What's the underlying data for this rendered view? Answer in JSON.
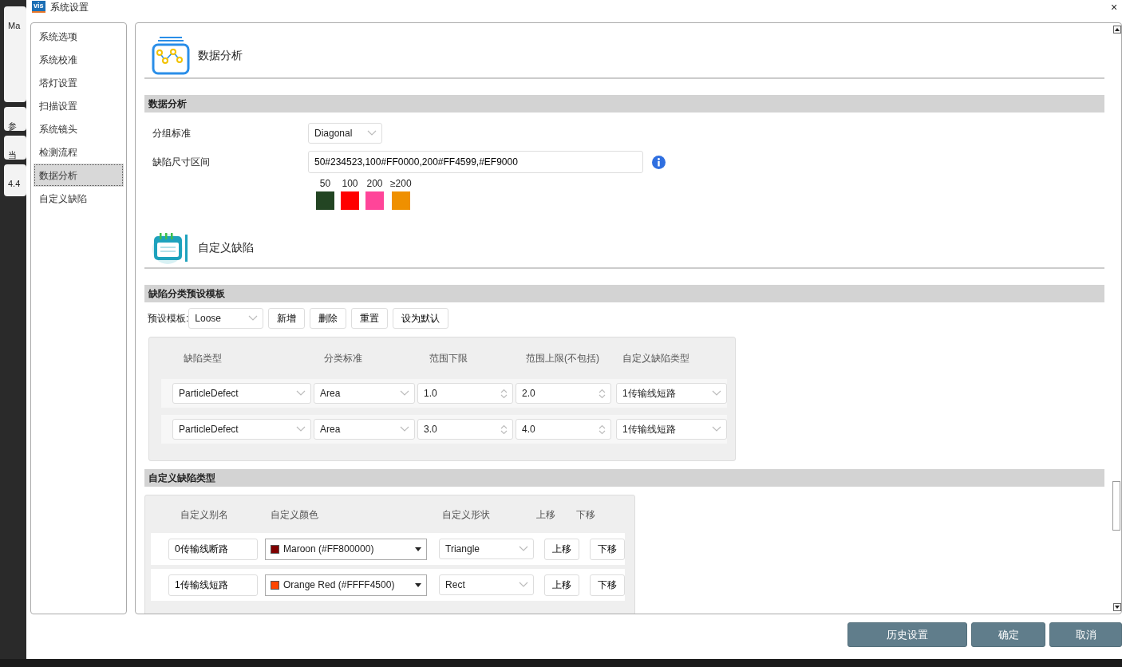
{
  "background_app": {
    "texts": [
      "Ma",
      "参",
      "当",
      "4.4"
    ]
  },
  "window": {
    "title": "系统设置",
    "logo": "vis",
    "close": "×"
  },
  "sidebar": {
    "items": [
      {
        "label": "系统选项",
        "selected": false
      },
      {
        "label": "系统校准",
        "selected": false
      },
      {
        "label": "塔灯设置",
        "selected": false
      },
      {
        "label": "扫描设置",
        "selected": false
      },
      {
        "label": "系统镜头",
        "selected": false
      },
      {
        "label": "检测流程",
        "selected": false
      },
      {
        "label": "数据分析",
        "selected": true
      },
      {
        "label": "自定义缺陷",
        "selected": false
      }
    ]
  },
  "data_analysis": {
    "heading": "数据分析",
    "panel_title": "数据分析",
    "group_label": "分组标准",
    "group_value": "Diagonal",
    "size_label": "缺陷尺寸区间",
    "size_value": "50#234523,100#FF0000,200#FF4599,#EF9000",
    "legend": [
      {
        "label": "50",
        "color": "#234523"
      },
      {
        "label": "100",
        "color": "#ff0000"
      },
      {
        "label": "200",
        "color": "#ff4599"
      },
      {
        "label": "≥200",
        "color": "#ef9000"
      }
    ]
  },
  "custom_defect": {
    "heading": "自定义缺陷",
    "template_panel": {
      "title": "缺陷分类预设模板",
      "preset_label": "预设模板:",
      "preset_value": "Loose",
      "buttons": [
        "新增",
        "删除",
        "重置",
        "设为默认"
      ],
      "columns": [
        "缺陷类型",
        "分类标准",
        "范围下限",
        "范围上限(不包括)",
        "自定义缺陷类型"
      ],
      "rows": [
        {
          "defect_type": "ParticleDefect",
          "criterion": "Area",
          "lower": "1.0",
          "upper": "2.0",
          "custom_type": "1传输线短路"
        },
        {
          "defect_type": "ParticleDefect",
          "criterion": "Area",
          "lower": "3.0",
          "upper": "4.0",
          "custom_type": "1传输线短路"
        }
      ]
    },
    "types_panel": {
      "title": "自定义缺陷类型",
      "columns": [
        "自定义别名",
        "自定义颜色",
        "自定义形状",
        "上移",
        "下移"
      ],
      "rows": [
        {
          "alias": "0传输线断路",
          "color_name": "Maroon (#FF800000)",
          "color": "#800000",
          "shape": "Triangle",
          "up": "上移",
          "down": "下移"
        },
        {
          "alias": "1传输线短路",
          "color_name": "Orange Red (#FFFF4500)",
          "color": "#ff4500",
          "shape": "Rect",
          "up": "上移",
          "down": "下移"
        }
      ]
    }
  },
  "footer_buttons": [
    "历史设置",
    "确定",
    "取消"
  ]
}
